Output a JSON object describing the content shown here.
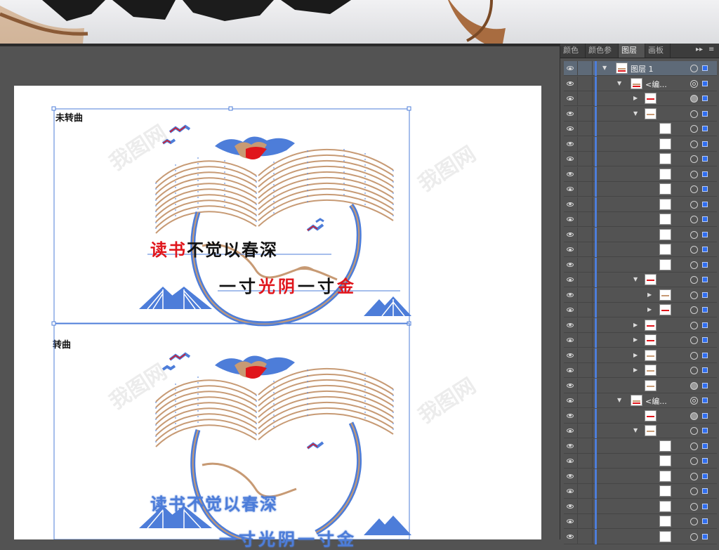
{
  "colors": {
    "selection_blue": "#4d7dd9",
    "accent_red": "#e0151b",
    "line_tan": "#c79a74",
    "panel_bg": "#535353",
    "workspace_bg": "#535353"
  },
  "panel": {
    "tabs": [
      {
        "label": "颜色"
      },
      {
        "label": "颜色参"
      },
      {
        "label": "图层",
        "active": true
      },
      {
        "label": "画板"
      }
    ],
    "menu_icons": [
      "panel-expand-icon",
      "panel-menu-icon"
    ]
  },
  "canvas": {
    "labels": {
      "top_artboard": "未转曲",
      "bottom_artboard": "转曲"
    },
    "phrases": {
      "line1_red": "读书",
      "line1_black": "不觉以春深",
      "line2_black_a": "一寸",
      "line2_red_a": "光阴",
      "line2_black_b": "一寸",
      "line2_red_b": "金"
    },
    "watermark": "我图网"
  },
  "layers": [
    {
      "name": "图层 1",
      "indent": 0,
      "twirl": "down",
      "thumb": "art",
      "selected": true,
      "target": "ring"
    },
    {
      "name": "<编...",
      "indent": 1,
      "twirl": "down",
      "thumb": "art",
      "target": "double"
    },
    {
      "name": "",
      "indent": 2,
      "twirl": "right",
      "thumb": "red",
      "target": "filled"
    },
    {
      "name": "",
      "indent": 2,
      "twirl": "down",
      "thumb": "tan",
      "target": "ring"
    },
    {
      "name": "",
      "indent": 3,
      "twirl": "none",
      "thumb": "blank",
      "target": "ring"
    },
    {
      "name": "",
      "indent": 3,
      "twirl": "none",
      "thumb": "blank",
      "target": "ring"
    },
    {
      "name": "",
      "indent": 3,
      "twirl": "none",
      "thumb": "blank",
      "target": "ring"
    },
    {
      "name": "",
      "indent": 3,
      "twirl": "none",
      "thumb": "blank",
      "target": "ring"
    },
    {
      "name": "",
      "indent": 3,
      "twirl": "none",
      "thumb": "blank",
      "target": "ring"
    },
    {
      "name": "",
      "indent": 3,
      "twirl": "none",
      "thumb": "blank",
      "target": "ring"
    },
    {
      "name": "",
      "indent": 3,
      "twirl": "none",
      "thumb": "blank",
      "target": "ring"
    },
    {
      "name": "",
      "indent": 3,
      "twirl": "none",
      "thumb": "blank",
      "target": "ring"
    },
    {
      "name": "",
      "indent": 3,
      "twirl": "none",
      "thumb": "blank",
      "target": "ring"
    },
    {
      "name": "",
      "indent": 3,
      "twirl": "none",
      "thumb": "blank",
      "target": "ring"
    },
    {
      "name": "",
      "indent": 2,
      "twirl": "down",
      "thumb": "red",
      "target": "ring"
    },
    {
      "name": "",
      "indent": 3,
      "twirl": "right",
      "thumb": "tan",
      "target": "ring"
    },
    {
      "name": "",
      "indent": 3,
      "twirl": "right",
      "thumb": "red",
      "target": "ring"
    },
    {
      "name": "",
      "indent": 2,
      "twirl": "right",
      "thumb": "red",
      "target": "ring"
    },
    {
      "name": "",
      "indent": 2,
      "twirl": "right",
      "thumb": "red",
      "target": "ring"
    },
    {
      "name": "",
      "indent": 2,
      "twirl": "right",
      "thumb": "tan",
      "target": "ring"
    },
    {
      "name": "",
      "indent": 2,
      "twirl": "right",
      "thumb": "tan",
      "target": "ring"
    },
    {
      "name": "",
      "indent": 2,
      "twirl": "none",
      "thumb": "tan",
      "target": "filled"
    },
    {
      "name": "<编...",
      "indent": 1,
      "twirl": "down",
      "thumb": "art",
      "target": "double"
    },
    {
      "name": "",
      "indent": 2,
      "twirl": "none",
      "thumb": "red",
      "target": "filled"
    },
    {
      "name": "",
      "indent": 2,
      "twirl": "down",
      "thumb": "tan",
      "target": "ring"
    },
    {
      "name": "",
      "indent": 3,
      "twirl": "none",
      "thumb": "blank",
      "target": "ring"
    },
    {
      "name": "",
      "indent": 3,
      "twirl": "none",
      "thumb": "blank",
      "target": "ring"
    },
    {
      "name": "",
      "indent": 3,
      "twirl": "none",
      "thumb": "blank",
      "target": "ring"
    },
    {
      "name": "",
      "indent": 3,
      "twirl": "none",
      "thumb": "blank",
      "target": "ring"
    },
    {
      "name": "",
      "indent": 3,
      "twirl": "none",
      "thumb": "blank",
      "target": "ring"
    },
    {
      "name": "",
      "indent": 3,
      "twirl": "none",
      "thumb": "blank",
      "target": "ring"
    },
    {
      "name": "",
      "indent": 3,
      "twirl": "none",
      "thumb": "blank",
      "target": "ring"
    }
  ]
}
